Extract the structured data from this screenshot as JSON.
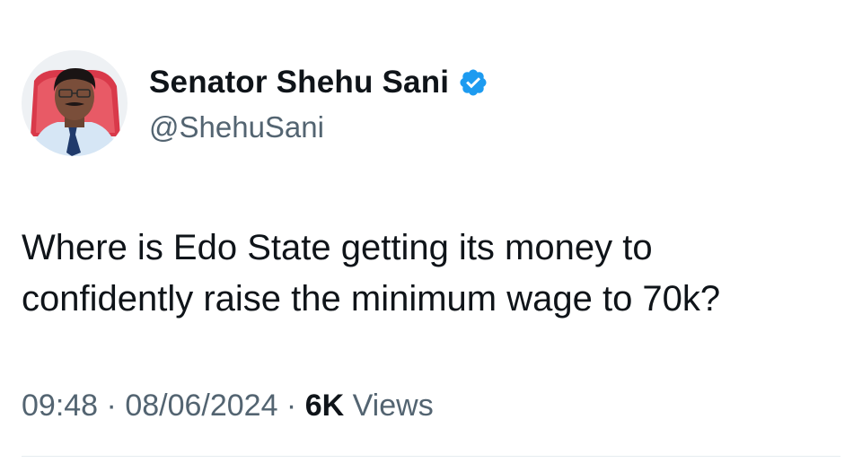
{
  "user": {
    "display_name": "Senator Shehu Sani",
    "handle": "@ShehuSani",
    "verified": true,
    "avatar_icon": "profile-photo"
  },
  "tweet": {
    "lines": [
      "Where is Edo State getting its money to",
      "confidently raise the minimum wage to 70k?"
    ]
  },
  "meta": {
    "time": "09:48",
    "separator": " · ",
    "date": "08/06/2024",
    "views_count": "6K",
    "views_label": " Views"
  },
  "colors": {
    "verified_blue": "#1d9bf0",
    "primary_text": "#0f1419",
    "secondary_text": "#536471"
  }
}
